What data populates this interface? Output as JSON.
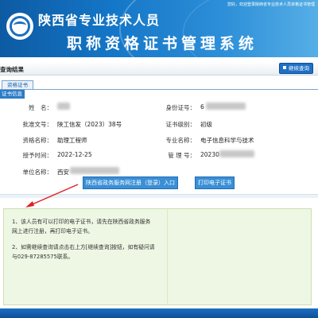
{
  "header": {
    "org_name": "陕西省专业技术人员",
    "system_name": "职称资格证书管理系统",
    "welcome": "您好，欢迎登录陕西省专业技术人员资格证书管理"
  },
  "result_bar": {
    "title": "查询结果",
    "continue_button": "继续查询"
  },
  "tab": {
    "label": "资格证书"
  },
  "section_label": "证书信息",
  "fields": {
    "name_label": "姓　名：",
    "name_value": "",
    "idcard_label": "身份证号：",
    "idcard_value": "6",
    "approval_label": "批准文号：",
    "approval_value": "陕工信发（2023）38号",
    "level_label": "证书级别：",
    "level_value": "初级",
    "qual_label": "资格名称：",
    "qual_value": "助理工程师",
    "major_label": "专业名称：",
    "major_value": "电子信息科学与技术",
    "date_label": "授予时间：",
    "date_value": "2022-12-25",
    "manage_label": "管 理 号：",
    "manage_value": "20230",
    "unit_label": "单位名称：",
    "unit_value": "西安"
  },
  "buttons": {
    "register": "陕西省政务服务网注册（登录）入口",
    "print": "打印电子证书"
  },
  "notice": {
    "item1": "1、该人员有可以打印的电子证书，请先在陕西省政务服务网上进行注册，再打印电子证书。",
    "item2": "2、如需继续查询请点击右上方[继续查询]按钮，如有疑问请与029-87285575联系。"
  },
  "colors": {
    "header_blue": "#1476c7",
    "button_blue": "#3a8fd6",
    "notice_green": "#eef7e4",
    "arrow_red": "#e02020"
  }
}
